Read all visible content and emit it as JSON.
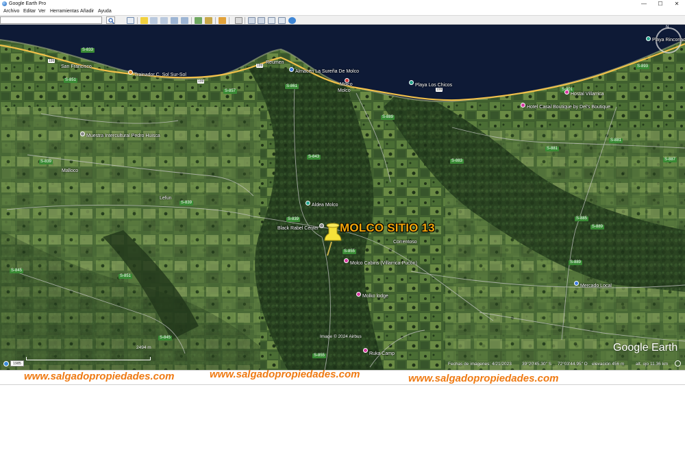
{
  "window": {
    "title": "Google Earth Pro",
    "controls": {
      "minimize": "—",
      "maximize": "☐",
      "close": "✕"
    }
  },
  "menu": {
    "items": [
      "Archivo",
      "Editar",
      "Ver",
      "Herramientas",
      "Añadir",
      "Ayuda"
    ]
  },
  "toolbar": {
    "search_value": "",
    "buttons": [
      "sidebar-toggle-icon",
      "placemark-icon",
      "polygon-icon",
      "path-icon",
      "image-overlay-icon",
      "record-tour-icon",
      "historical-imagery-icon",
      "sun-icon",
      "planet-icon",
      "ruler-icon",
      "email-icon",
      "print-icon",
      "save-image-icon",
      "map-view-icon",
      "google-maps-icon"
    ]
  },
  "map": {
    "placemark_title": "MOLCO SITIO 13",
    "labels": {
      "san_francisco": "San Francisco",
      "pitrufquen_farm": "Trainador C. Sol Sur-Sol",
      "reumen": "Reumen",
      "molco_road": "Molco",
      "molco_town": "Molco",
      "tienda": "Almacén La Sureña De Molco",
      "playa_chicos": "Playa Los Chicos",
      "playa_rinconada": "Playa Rinconada",
      "hostal": "Hostal Villarrica",
      "hotel": "Hotel Casal Boutique by Del's Boutique",
      "muestra": "Muestra Intercultural Pedro Huisca",
      "malloco": "Malloco",
      "lefun": "Lefun",
      "aldea": "Aldea Molco",
      "black_rabbit": "Black Rabel Center",
      "correntoso": "Correntoso",
      "molco_cabins": "Molco Cabins (Villarrica-Pucón)",
      "molko_lodge": "Molko lodge",
      "mercado": "Mercado Local",
      "ruka": "Ruka Camp"
    },
    "road_badges": {
      "r1": "S-833",
      "r2": "S-851",
      "r3": "S-857",
      "r4": "S-839",
      "r5": "S-839",
      "r6": "S-839",
      "r7": "S-843",
      "r8": "S-861",
      "r9": "S-855",
      "r10": "S-845",
      "r11": "S-851",
      "r12": "S-845",
      "r13": "S-855",
      "r14": "S-881",
      "r15": "S-883",
      "r16": "S-885",
      "r17": "S-889",
      "r18": "S-889",
      "r19": "S-881",
      "r20": "S-887",
      "r21": "S-893",
      "r22": "S-901",
      "r23": "S-889"
    },
    "highway_badges": {
      "h1": "199",
      "h2": "199",
      "h3": "199",
      "h4": "199"
    },
    "copyright": "Image © 2024 Airbus",
    "logo": "Google Earth",
    "compass_n": "N",
    "scale_label": "2494 m"
  },
  "statusbar": {
    "year": "1985",
    "imagery_date": "Fechas de imágenes: 4/21/2023",
    "lat": "39°20'45.30\" S",
    "lon": "72°03'44.95\" O",
    "elevation": "elevación   456 m",
    "altitude": "alt. ojo  11.36 km"
  },
  "watermark": {
    "texts": [
      "www.salgadopropiedades.com",
      "www.salgadopropiedades.com",
      "www.salgadopropiedades.com"
    ],
    "color": "#ef7a12"
  }
}
